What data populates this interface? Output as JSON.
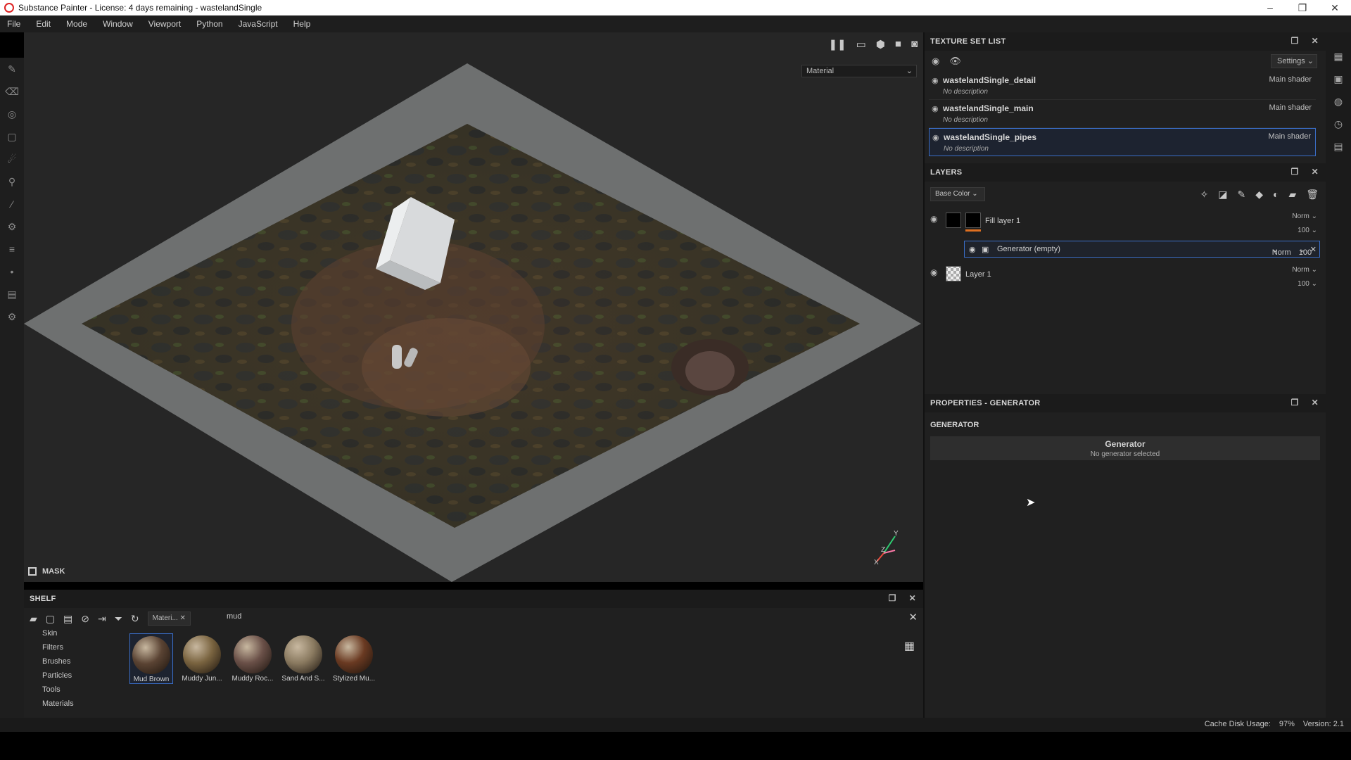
{
  "window": {
    "title": "Substance Painter - License: 4 days remaining - wastelandSingle",
    "minimize": "–",
    "maximize": "❐",
    "close": "✕"
  },
  "menu": [
    "File",
    "Edit",
    "Mode",
    "Window",
    "Viewport",
    "Python",
    "JavaScript",
    "Help"
  ],
  "viewport": {
    "mode_select": "Material",
    "mask_label": "MASK",
    "axis": {
      "y": "Y",
      "z": "Z",
      "x": "X"
    }
  },
  "texture_set_list": {
    "title": "TEXTURE SET LIST",
    "settings_label": "Settings",
    "sets": [
      {
        "name": "wastelandSingle_detail",
        "description": "No description",
        "shader": "Main shader"
      },
      {
        "name": "wastelandSingle_main",
        "description": "No description",
        "shader": "Main shader"
      },
      {
        "name": "wastelandSingle_pipes",
        "description": "No description",
        "shader": "Main shader"
      }
    ]
  },
  "layers": {
    "title": "LAYERS",
    "channel": "Base Color",
    "items": [
      {
        "name": "Fill layer 1",
        "blend": "Norm",
        "opacity": "100"
      },
      {
        "name": "Layer 1",
        "blend": "Norm",
        "opacity": "100"
      }
    ],
    "generator_effect": {
      "name": "Generator (empty)",
      "blend": "Norm",
      "opacity": "100"
    }
  },
  "properties": {
    "title": "PROPERTIES - GENERATOR",
    "section": "GENERATOR",
    "generator_label": "Generator",
    "generator_status": "No generator selected"
  },
  "shelf": {
    "title": "SHELF",
    "filter_tag": "Materi...",
    "search_text": "mud",
    "categories": [
      "Skin",
      "Filters",
      "Brushes",
      "Particles",
      "Tools",
      "Materials"
    ],
    "materials": [
      {
        "name": "Mud Brown",
        "color": "#5a4333"
      },
      {
        "name": "Muddy Jun...",
        "color": "#7a6440"
      },
      {
        "name": "Muddy Roc...",
        "color": "#6a5048"
      },
      {
        "name": "Sand And S...",
        "color": "#8a7a60"
      },
      {
        "name": "Stylized Mu...",
        "color": "#6a3a22"
      }
    ]
  },
  "status": {
    "cache_label": "Cache Disk Usage:",
    "cache_value": "97%",
    "version": "Version: 2.1"
  },
  "colors": {
    "accent": "#3a6ec8",
    "fill_marker": "#e07020"
  }
}
